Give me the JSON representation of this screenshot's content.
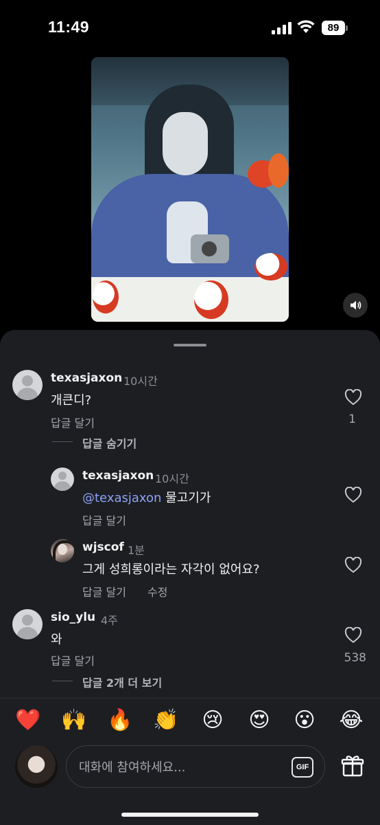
{
  "status_bar": {
    "time": "11:49",
    "battery": "89"
  },
  "video": {
    "description_icon": "sound-on-icon"
  },
  "comments": [
    {
      "username": "texasjaxon",
      "time": "10시간",
      "text": "개큰디?",
      "reply_label": "답글 달기",
      "likes": "1",
      "thread_toggle": "답글 숨기기"
    },
    {
      "username": "texasjaxon",
      "time": "10시간",
      "mention": "@texasjaxon",
      "text": "물고기가",
      "reply_label": "답글 달기"
    },
    {
      "username": "wjscof",
      "time": "1분",
      "text": "그게 성희롱이라는 자각이 없어요?",
      "reply_label": "답글 달기",
      "edit_label": "수정"
    },
    {
      "username": "sio_ylu",
      "time": "4주",
      "text": "와",
      "reply_label": "답글 달기",
      "likes": "538",
      "thread_toggle": "답글 2개 더 보기"
    }
  ],
  "reactions": [
    "❤️",
    "🙌",
    "🔥",
    "👏",
    "😢",
    "😍",
    "😮",
    "😂"
  ],
  "composer": {
    "placeholder": "대화에 참여하세요...",
    "gif_label": "GIF"
  },
  "colors": {
    "sheet_bg": "#1c1e22",
    "mention": "#8ea2f7",
    "text_secondary": "#a5a7ac"
  }
}
